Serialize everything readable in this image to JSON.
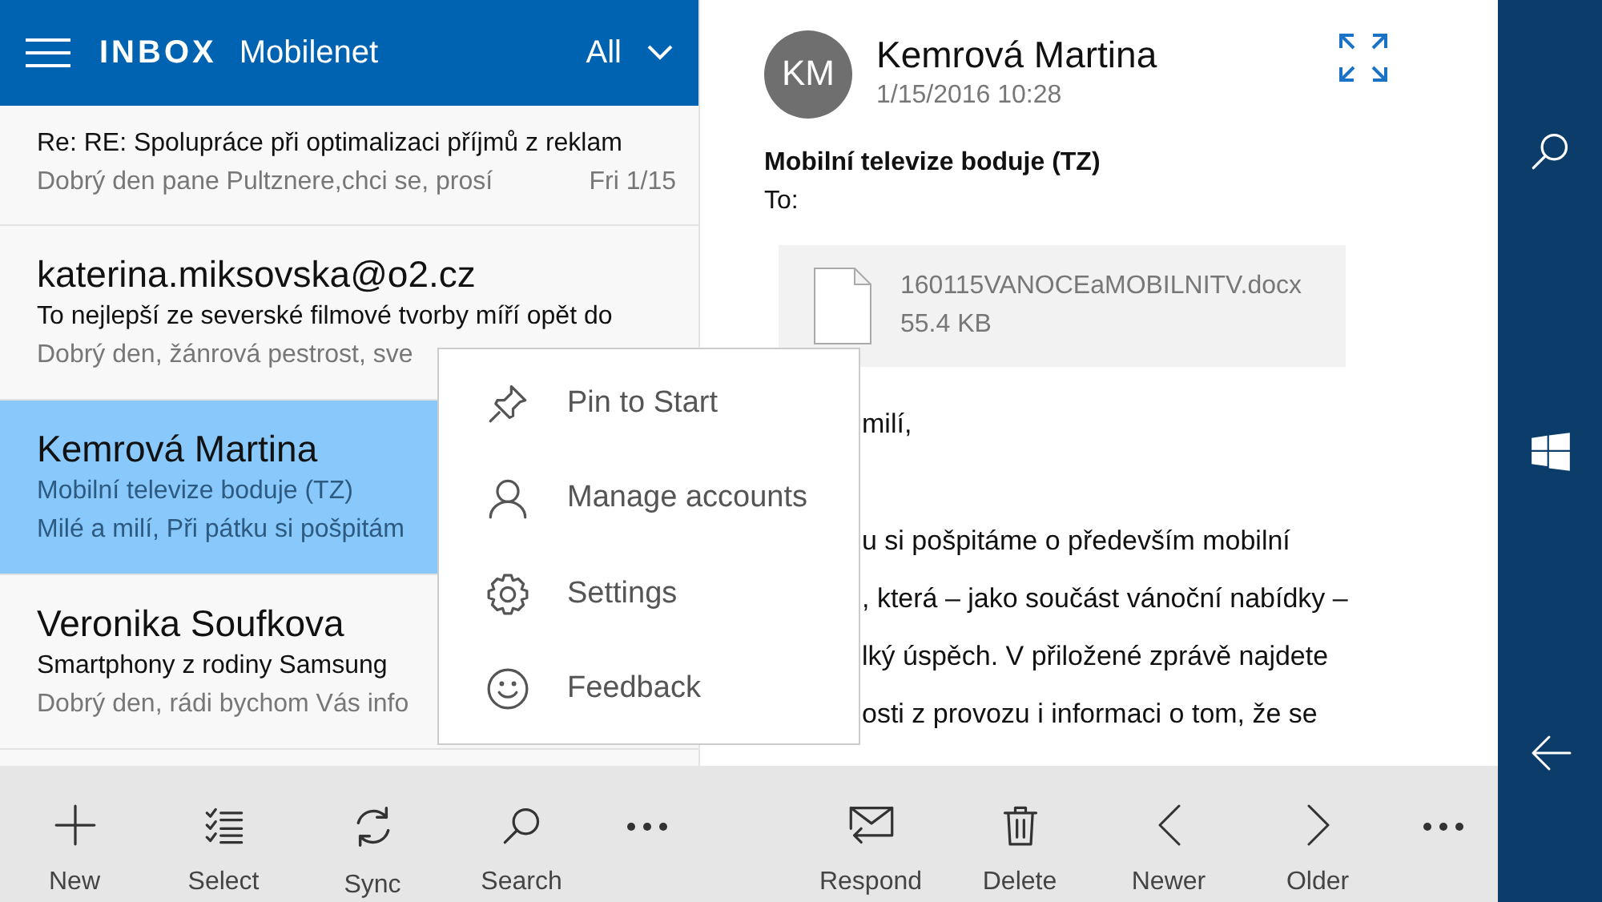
{
  "header": {
    "title": "INBOX",
    "account": "Mobilenet",
    "filter": "All"
  },
  "messages": [
    {
      "subject": "Re: RE: Spolupráce při optimalizaci příjmů z reklam",
      "preview": "Dobrý den pane Pultznere,chci se, prosí",
      "date": "Fri 1/15",
      "selected": false
    },
    {
      "sender": "katerina.miksovska@o2.cz",
      "subject": "To nejlepší ze severské filmové tvorby míří opět do",
      "preview": "Dobrý den, žánrová pestrost, sve",
      "selected": false
    },
    {
      "sender": "Kemrová Martina",
      "subject": "Mobilní televize boduje (TZ)",
      "preview": "Milé a milí, Při pátku si pošpitám",
      "selected": true
    },
    {
      "sender": "Veronika Soufkova",
      "subject": "Smartphony z rodiny Samsung",
      "preview": "Dobrý den, rádi bychom Vás info",
      "selected": false
    }
  ],
  "context_menu": [
    {
      "kind": "pin",
      "label": "Pin to Start"
    },
    {
      "kind": "person",
      "label": "Manage accounts"
    },
    {
      "kind": "gear",
      "label": "Settings"
    },
    {
      "kind": "smiley",
      "label": "Feedback"
    }
  ],
  "reading_pane": {
    "initials": "KM",
    "sender": "Kemrová Martina",
    "date": "1/15/2016 10:28",
    "subject": "Mobilní televize boduje (TZ)",
    "to_label": "To:",
    "attachment": {
      "name": "160115VANOCEaMOBILNITV.docx",
      "size": "55.4 KB"
    },
    "body": [
      [
        "milí,"
      ],
      [
        "u si pošpitáme o především mobilní",
        ", která – jako součást vánoční nabídky –",
        "lký úspěch. V přiložené zprávě najdete",
        "osti z provozu i informaci o tom, že se"
      ]
    ]
  },
  "list_commands": [
    {
      "kind": "plus",
      "label": "New"
    },
    {
      "kind": "select",
      "label": "Select"
    },
    {
      "kind": "sync",
      "label": "Sync"
    },
    {
      "kind": "search",
      "label": "Search"
    },
    {
      "kind": "more"
    }
  ],
  "reading_commands": [
    {
      "kind": "respond",
      "label": "Respond"
    },
    {
      "kind": "delete",
      "label": "Delete"
    },
    {
      "kind": "left",
      "label": "Newer"
    },
    {
      "kind": "right",
      "label": "Older"
    },
    {
      "kind": "more"
    }
  ],
  "nav_buttons": [
    {
      "kind": "search"
    },
    {
      "kind": "windows"
    },
    {
      "kind": "back"
    }
  ]
}
